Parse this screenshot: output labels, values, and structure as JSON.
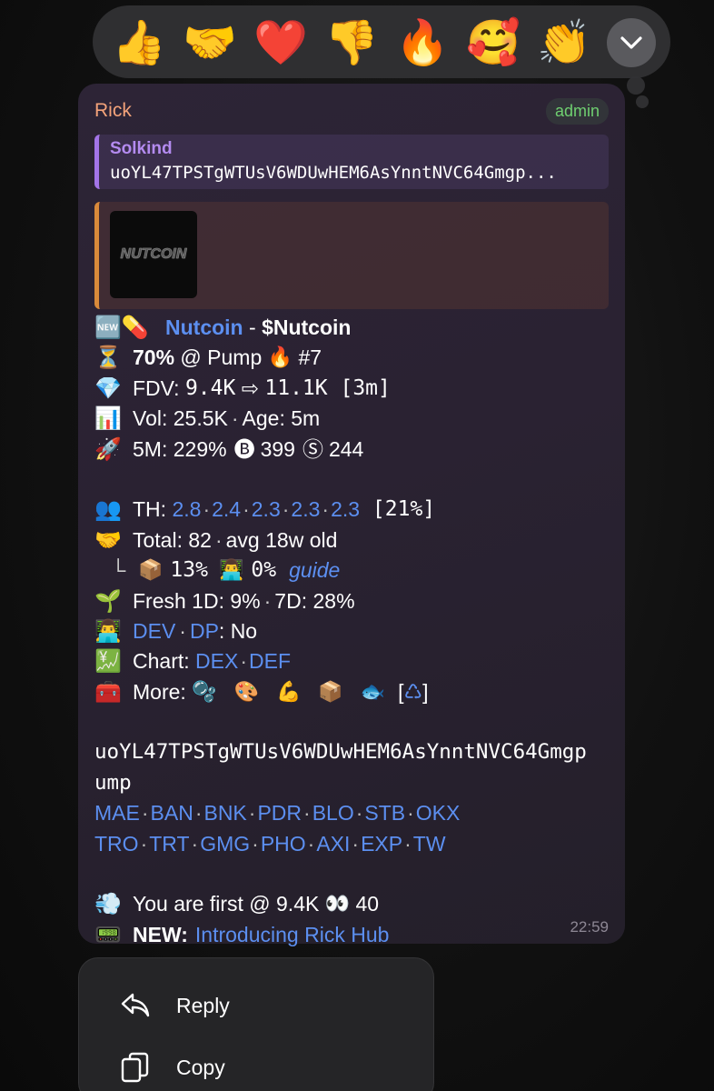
{
  "reactions": [
    {
      "name": "thumbs-up-reaction",
      "glyph": "👍"
    },
    {
      "name": "handshake-reaction",
      "glyph": "🤝"
    },
    {
      "name": "heart-reaction",
      "glyph": "❤️"
    },
    {
      "name": "thumbs-down-reaction",
      "glyph": "👎"
    },
    {
      "name": "fire-reaction",
      "glyph": "🔥"
    },
    {
      "name": "smiling-hearts-reaction",
      "glyph": "🥰"
    },
    {
      "name": "clapping-reaction",
      "glyph": "👏"
    }
  ],
  "reaction_expand_icon": "chevron-down-icon",
  "message": {
    "sender": "Rick",
    "badge": "admin",
    "reply_quote": {
      "name": "Solkind",
      "text": "uoYL47TPSTgWTUsV6WDUwHEM6AsYnntNVC64Gmgp..."
    },
    "preview_logo_text": "NUTCOIN",
    "token": {
      "icons": "🆕💊",
      "name": "Nutcoin",
      "dash": " - ",
      "ticker": "$Nutcoin"
    },
    "pump_line": {
      "icon": "⏳",
      "percent": "70%",
      "at": " @ Pump ",
      "fire": "🔥",
      "rank": " #7"
    },
    "fdv_line": {
      "icon": "💎",
      "label": "FDV: ",
      "from": "9.4K",
      "arrow": " ⇨ ",
      "to": "11.1K",
      "window": " [3m]"
    },
    "vol_line": {
      "icon": "📊",
      "label": "Vol: ",
      "vol": "25.5K",
      "age_label": "Age: ",
      "age": "5m"
    },
    "fivem_line": {
      "icon": "🚀",
      "label": "5M: ",
      "pct": "229%",
      "buy_icon": "🅑",
      "buys": "399",
      "sell_icon": "Ⓢ",
      "sells": "244"
    },
    "th_line": {
      "icon": "👥",
      "label": "TH: ",
      "values": [
        "2.8",
        "2.4",
        "2.3",
        "2.3",
        "2.3"
      ],
      "pct": " [21%]"
    },
    "total_line": {
      "icon": "🤝",
      "label": "Total: ",
      "count": "82",
      "avg": "avg 18w old"
    },
    "sub_line": {
      "branch": "└",
      "box_icon": "📦",
      "box_pct": "13%",
      "dev_icon": "👨‍💻",
      "dev_pct": "0%",
      "guide": "guide"
    },
    "fresh_line": {
      "icon": "🌱",
      "label": "Fresh 1D: ",
      "d1": "9%",
      "d7_label": "7D: ",
      "d7": "28%"
    },
    "dev_line": {
      "icon": "👨‍💻",
      "dev": "DEV",
      "dp": "DP",
      "dp_value": ": No"
    },
    "chart_line": {
      "icon": "💹",
      "label": "Chart: ",
      "dex": "DEX",
      "def": "DEF"
    },
    "more_line": {
      "icon": "🧰",
      "label": "More: ",
      "icons": "🫧 🎨 💪 📦 🐟",
      "recycle": "♺"
    },
    "contract_address_1": "uoYL47TPSTgWTUsV6WDUwHEM6AsYnntNVC64Gmgp",
    "contract_address_2": "ump",
    "links_row_1": [
      "MAE",
      "BAN",
      "BNK",
      "PDR",
      "BLO",
      "STB",
      "OKX"
    ],
    "links_row_2": [
      "TRO",
      "TRT",
      "GMG",
      "PHO",
      "AXI",
      "EXP",
      "TW"
    ],
    "first_line": {
      "icon": "💨",
      "text": "You are first @ 9.4K ",
      "eyes": "👀",
      "count": " 40"
    },
    "news_line": {
      "icon": "📟",
      "label": "NEW:",
      "link": "Introducing Rick Hub"
    },
    "time": "22:59"
  },
  "context_menu": [
    {
      "label": "Reply",
      "icon": "reply-icon"
    },
    {
      "label": "Copy",
      "icon": "copy-icon"
    }
  ],
  "colors": {
    "link": "#5c8ff0",
    "sender": "#f4a37a",
    "admin": "#6fcf70",
    "quote_accent": "#a374e8",
    "preview_accent": "#d98a3a"
  }
}
